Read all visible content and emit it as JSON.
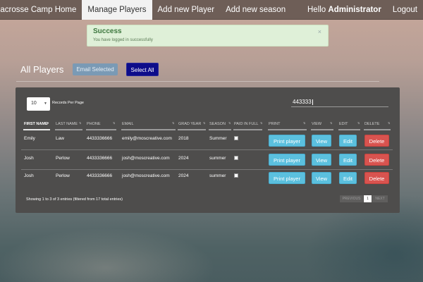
{
  "nav": {
    "brand": "Lacrosse Camp Home",
    "items": [
      "Manage Players",
      "Add new Player",
      "Add new season"
    ],
    "hello_prefix": "Hello ",
    "hello_user": "Administrator",
    "logout": "Logout"
  },
  "alert": {
    "title": "Success",
    "message": "You have logged in successfully",
    "close": "×"
  },
  "header": {
    "title": "All Players",
    "email_selected": "Email Selected",
    "select_all": "Select All"
  },
  "controls": {
    "records_value": "10",
    "records_label": "Records Per Page",
    "search_value": "443333"
  },
  "table": {
    "columns": [
      "FIRST NAME",
      "LAST NAME",
      "PHONE",
      "EMAIL",
      "GRAD YEAR",
      "SEASON",
      "PAID IN FULL",
      "PRINT",
      "VIEW",
      "EDIT",
      "DELETE"
    ],
    "rows": [
      {
        "first": "Emily",
        "last": "Law",
        "phone": "4433336666",
        "email": "emily@moscreative.com",
        "grad": "2018",
        "season": "Summer",
        "paid": false
      },
      {
        "first": "Josh",
        "last": "Perlow",
        "phone": "4433336666",
        "email": "josh@moscreative.com",
        "grad": "2024",
        "season": "summer",
        "paid": false
      },
      {
        "first": "Josh",
        "last": "Perlow",
        "phone": "4433336666",
        "email": "josh@moscreative.com",
        "grad": "2024",
        "season": "summer",
        "paid": false
      }
    ],
    "actions": {
      "print": "Print player",
      "view": "View",
      "edit": "Edit",
      "delete": "Delete"
    }
  },
  "footer": {
    "info": "Showing 1 to 3 of 3 entries (filtered from 17 total entries)",
    "prev": "PREVIOUS",
    "page": "1",
    "next": "NEXT"
  },
  "colors": {
    "navbar": "#6e5e57",
    "alert_bg": "#dff0d8",
    "select_all": "#0d0d8a",
    "info_button": "#5bc0de",
    "danger_button": "#d9534f",
    "panel": "#4e4d4c"
  }
}
